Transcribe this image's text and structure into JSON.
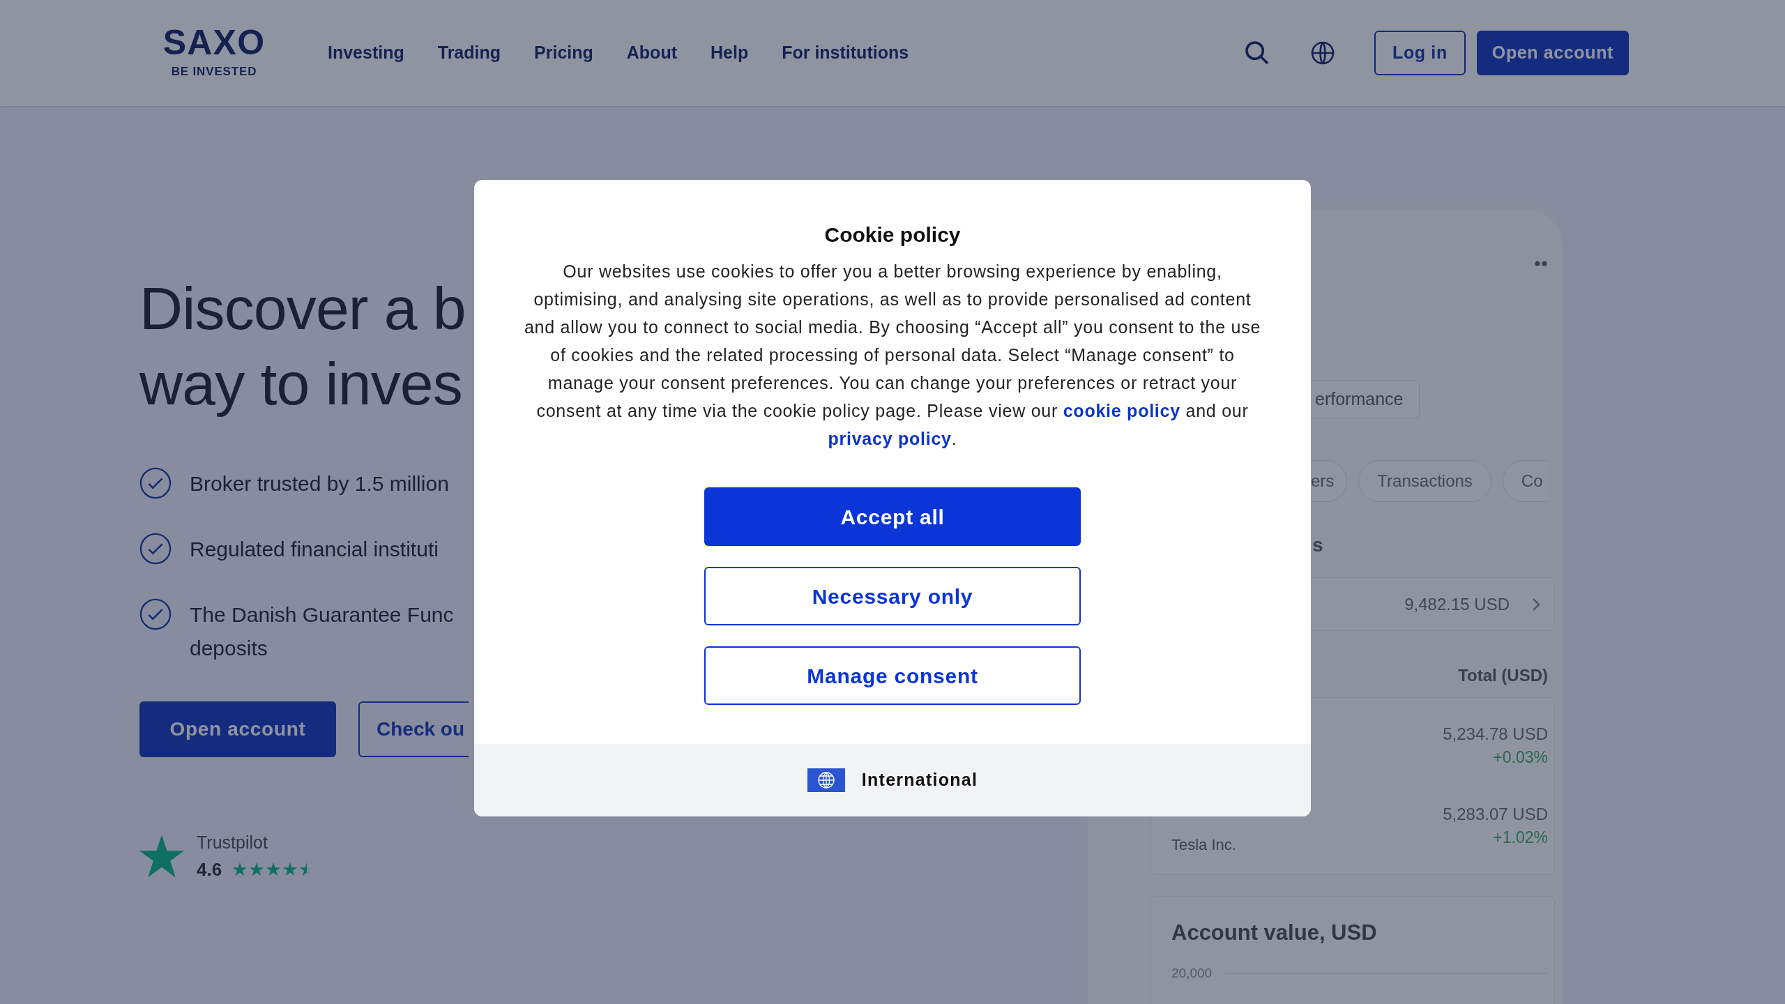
{
  "header": {
    "logo": {
      "wordmark": "SAXO",
      "tagline": "BE INVESTED"
    },
    "nav": [
      "Investing",
      "Trading",
      "Pricing",
      "About",
      "Help",
      "For institutions"
    ],
    "login_button": "Log in",
    "open_account_button": "Open account"
  },
  "hero": {
    "heading_lines": [
      "Discover a b",
      "way to inves"
    ],
    "features": [
      {
        "lines": [
          "Broker trusted by 1.5 million"
        ]
      },
      {
        "lines": [
          "Regulated financial instituti"
        ]
      },
      {
        "lines": [
          "The Danish Guarantee Func",
          "deposits"
        ]
      }
    ],
    "buttons": [
      {
        "label": "Open account",
        "kind": "primary"
      },
      {
        "label": "Check ou",
        "kind": "outline"
      }
    ],
    "trustpilot": {
      "label": "Trustpilot",
      "score": "4.6",
      "stars": 4.5
    }
  },
  "app_preview": {
    "tab": "erformance",
    "pills": [
      "ers",
      "Transactions",
      "Co"
    ],
    "section_heading": "s",
    "balance": "9,482.15 USD",
    "column_header": "Total (USD)",
    "holdings": [
      {
        "value": "5,234.78 USD",
        "change": "+0.03%"
      },
      {
        "name": "Tesla Inc.",
        "value": "5,283.07 USD",
        "change": "+1.02%"
      }
    ],
    "chart_title": "Account value, USD",
    "axis_label": "20,000"
  },
  "cookie_dialog": {
    "title": "Cookie policy",
    "body": [
      {
        "text": "Our websites use cookies to offer you a better browsing experience by enabling, optimising, and analysing site operations, as well as to provide personalised ad content and allow you to connect to social media. By choosing “Accept all” you consent to the use of cookies and the related processing of personal data. Select “Manage consent” to manage your consent preferences. You can change your preferences or retract your consent at any time via the cookie policy page. Please view our ",
        "kind": "text"
      },
      {
        "text": "cookie policy",
        "kind": "link"
      },
      {
        "text": " and our ",
        "kind": "text"
      },
      {
        "text": "privacy policy",
        "kind": "link"
      },
      {
        "text": ".",
        "kind": "text"
      }
    ],
    "buttons": [
      {
        "label": "Accept all",
        "kind": "primary"
      },
      {
        "label": "Necessary only",
        "kind": "outline"
      },
      {
        "label": "Manage consent",
        "kind": "outline"
      }
    ],
    "region": "International"
  }
}
